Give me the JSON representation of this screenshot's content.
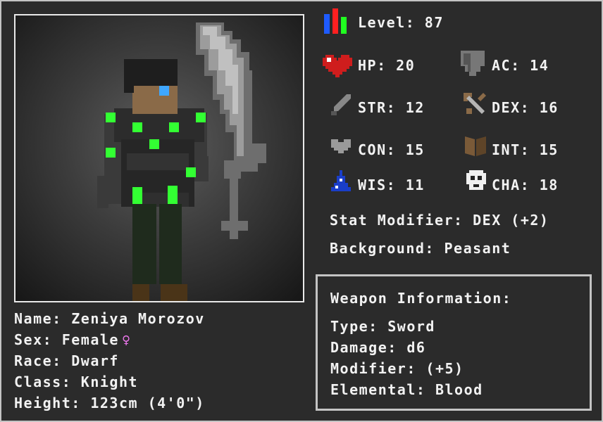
{
  "level": {
    "label": "Level:",
    "value": "87"
  },
  "stats": {
    "hp": {
      "label": "HP:",
      "value": "20"
    },
    "ac": {
      "label": "AC:",
      "value": "14"
    },
    "str": {
      "label": "STR:",
      "value": "12"
    },
    "dex": {
      "label": "DEX:",
      "value": "16"
    },
    "con": {
      "label": "CON:",
      "value": "15"
    },
    "int": {
      "label": "INT:",
      "value": "15"
    },
    "wis": {
      "label": "WIS:",
      "value": "11"
    },
    "cha": {
      "label": "CHA:",
      "value": "18"
    }
  },
  "stat_modifier": "Stat Modifier: DEX (+2)",
  "background": "Background: Peasant",
  "character": {
    "name": "Name: Zeniya Morozov",
    "sex": "Sex: Female",
    "sex_symbol": "♀",
    "race": "Race: Dwarf",
    "class": "Class: Knight",
    "height": "Height: 123cm (4'0\")"
  },
  "weapon": {
    "title": "Weapon Information:",
    "type": "Type: Sword",
    "damage": "Damage: d6",
    "modifier": "Modifier: (+5)",
    "elemental": "Elemental: Blood"
  },
  "colors": {
    "accent_green": "#33ff33",
    "sex_symbol": "#ee77ee"
  }
}
